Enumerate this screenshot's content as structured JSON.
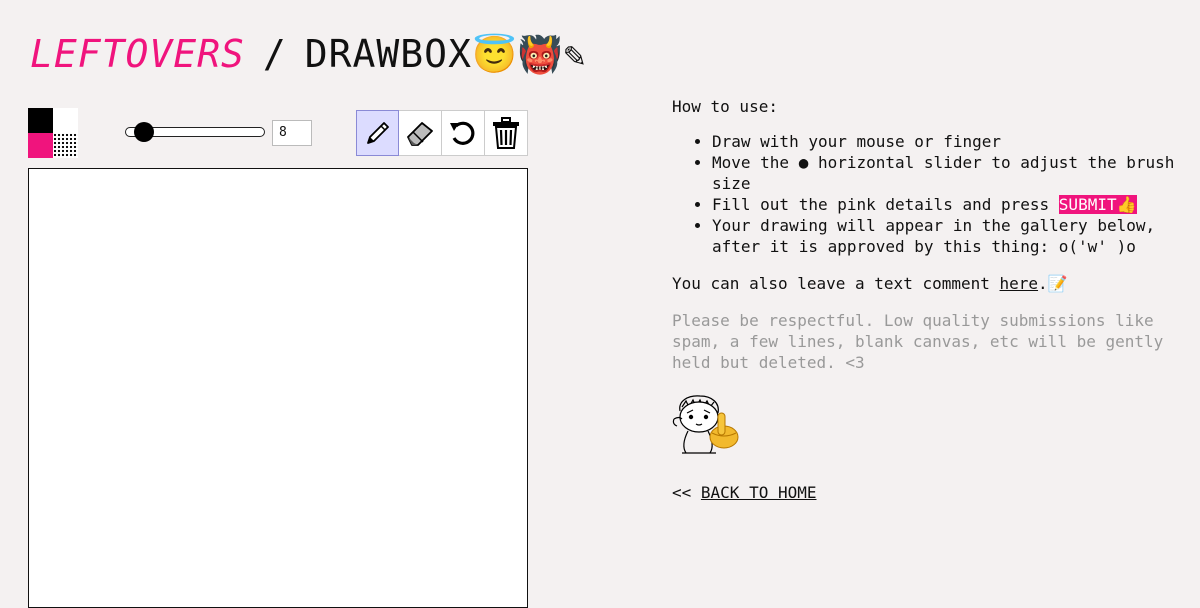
{
  "header": {
    "brand": "LEFTOVERS",
    "separator": "/",
    "page_title": "DRAWBOX",
    "emoji": [
      "😇",
      "👹",
      "✎"
    ]
  },
  "toolbar": {
    "colors": [
      "#000000",
      "#ffffff",
      "#f0147d",
      "dotted"
    ],
    "brush_size": "8",
    "brush_slider_fraction": 0.06,
    "tools": [
      "pencil-icon",
      "eraser-icon",
      "undo-icon",
      "trash-icon"
    ],
    "active_tool": "pencil-icon"
  },
  "instructions": {
    "heading": "How to use:",
    "items": [
      "Draw with your mouse or finger",
      "Move the ● horizontal slider to adjust the brush size",
      "Fill out the pink details and press",
      "Your drawing will appear in the gallery below, after it is approved by this thing: o('w' )o"
    ],
    "submit_label": "SUBMIT👍"
  },
  "comment": {
    "prefix": "You can also leave a text comment ",
    "link": "here",
    "suffix": ".📝"
  },
  "note": "Please be respectful. Low quality submissions like spam, a few lines, blank canvas, etc will be gently held but deleted. <3",
  "back": {
    "prefix": "<< ",
    "link": "BACK TO HOME"
  },
  "colors": {
    "accent": "#f0147d",
    "background": "#f4f1f1"
  }
}
